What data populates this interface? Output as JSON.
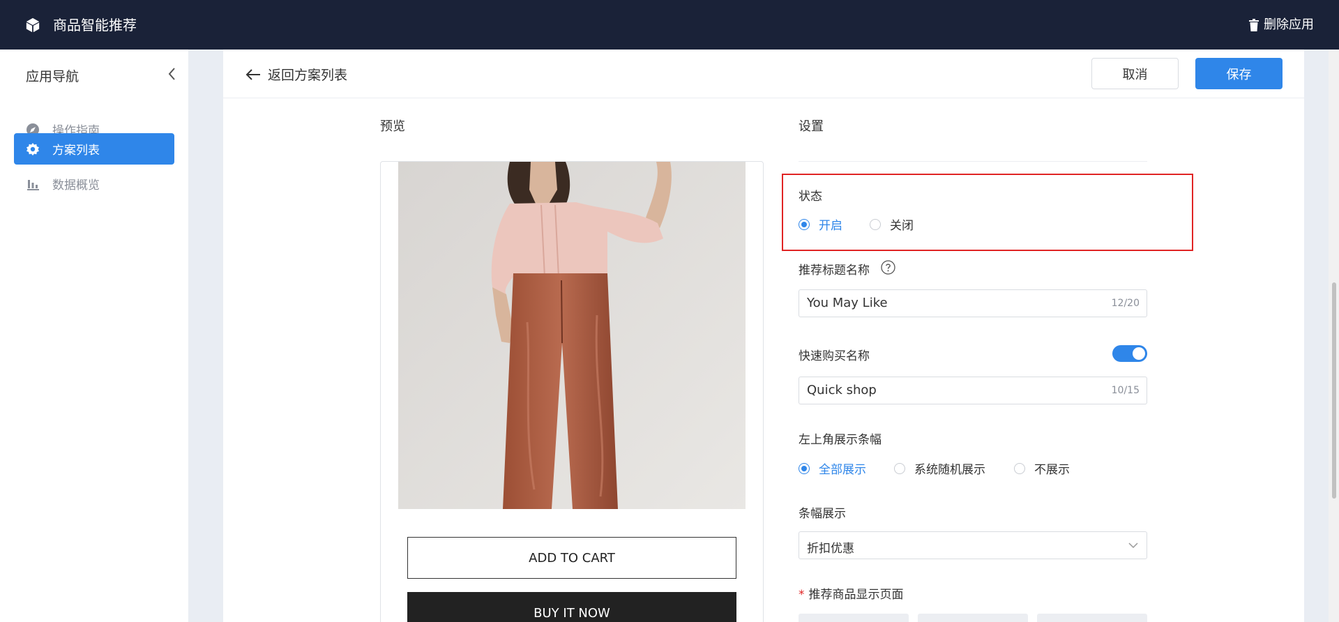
{
  "app": {
    "title": "商品智能推荐",
    "delete_label": "删除应用"
  },
  "sidebar": {
    "title": "应用导航",
    "items": [
      {
        "label": "操作指南",
        "icon": "navigation-icon",
        "active": false
      },
      {
        "label": "方案列表",
        "icon": "gear-icon",
        "active": true
      },
      {
        "label": "数据概览",
        "icon": "bar-chart-icon",
        "active": false
      }
    ]
  },
  "header": {
    "back_label": "返回方案列表",
    "cancel_label": "取消",
    "save_label": "保存"
  },
  "preview": {
    "label": "预览",
    "add_to_cart": "ADD TO CART",
    "buy_now": "BUY IT NOW"
  },
  "settings": {
    "label": "设置",
    "status": {
      "label": "状态",
      "options": [
        "开启",
        "关闭"
      ],
      "selected": "开启"
    },
    "title_name": {
      "label": "推荐标题名称",
      "value": "You May Like",
      "count": "12/20"
    },
    "quick_buy": {
      "label": "快速购买名称",
      "enabled": true,
      "value": "Quick shop",
      "count": "10/15"
    },
    "banner_corner": {
      "label": "左上角展示条幅",
      "options": [
        "全部展示",
        "系统随机展示",
        "不展示"
      ],
      "selected": "全部展示"
    },
    "banner_display": {
      "label": "条幅展示",
      "value": "折扣优惠"
    },
    "display_pages": {
      "label": "推荐商品显示页面",
      "required_mark": "*"
    }
  },
  "colors": {
    "accent": "#2f86e9",
    "topbar": "#1a2238",
    "highlight": "#e02424"
  }
}
